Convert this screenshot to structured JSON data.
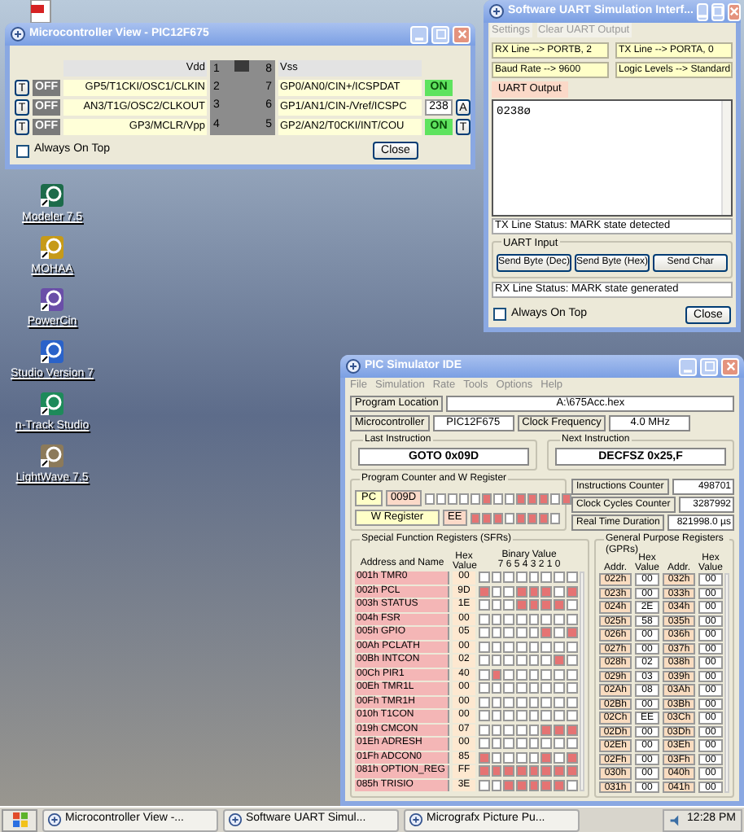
{
  "desktop_icons": [
    {
      "kind": "pdf"
    },
    {
      "kind": "app",
      "label": "Modeler 7.5"
    },
    {
      "kind": "app",
      "label": "MOHAA"
    },
    {
      "kind": "app",
      "label": "PowerCin"
    },
    {
      "kind": "app",
      "label": "Studio Version 7"
    },
    {
      "kind": "app",
      "label": "n-Track Studio"
    },
    {
      "kind": "app",
      "label": "LightWave 7.5"
    }
  ],
  "mcu_window": {
    "title": "Microcontroller View - PIC12F675",
    "pins": [
      {
        "kind": "power",
        "left": {
          "number": "1",
          "label": "Vdd"
        },
        "right": {
          "number": "8",
          "label": "Vss"
        }
      },
      {
        "kind": "io",
        "left": {
          "number": "2",
          "label": "GP5/T1CKI/OSC1/CLKIN",
          "button": "T",
          "state": {
            "text": "OFF",
            "on": false
          }
        },
        "right": {
          "number": "7",
          "label": "GP0/AN0/CIN+/ICSPDAT",
          "state": {
            "text": "ON",
            "on": true
          }
        }
      },
      {
        "kind": "io",
        "left": {
          "number": "3",
          "label": "AN3/T1G/OSC2/CLKOUT",
          "button": "T",
          "state": {
            "text": "OFF",
            "on": false
          }
        },
        "right": {
          "number": "6",
          "label": "GP1/AN1/CIN-/Vref/ICSPC",
          "analog": "238",
          "button": "A"
        }
      },
      {
        "kind": "io",
        "left": {
          "number": "4",
          "label": "GP3/MCLR/Vpp",
          "button": "T",
          "state": {
            "text": "OFF",
            "on": false
          }
        },
        "right": {
          "number": "5",
          "label": "GP2/AN2/T0CKI/INT/COU",
          "state": {
            "text": "ON",
            "on": true
          },
          "button": "T"
        }
      }
    ],
    "always_on_top": {
      "label": "Always On Top",
      "checked": false
    },
    "close": "Close"
  },
  "uart_window": {
    "title": "Software UART Simulation Interf...",
    "menu": [
      "Settings",
      "Clear UART Output"
    ],
    "info": [
      "RX Line --> PORTB, 2",
      "TX Line --> PORTA, 0",
      "Baud Rate --> 9600",
      "Logic Levels --> Standard"
    ],
    "output_label": "UART Output",
    "output": "0238ø",
    "tx_status": "TX Line Status: MARK state detected",
    "input_group": "UART Input",
    "buttons": [
      "Send Byte (Dec)",
      "Send Byte (Hex)",
      "Send Char"
    ],
    "rx_status": "RX Line Status: MARK state generated",
    "always_on_top": {
      "label": "Always On Top",
      "checked": false
    },
    "close": "Close"
  },
  "ide_window": {
    "title": "PIC Simulator IDE",
    "menu": [
      "File",
      "Simulation",
      "Rate",
      "Tools",
      "Options",
      "Help"
    ],
    "program_location": {
      "label": "Program Location",
      "value": "A:\\675Acc.hex"
    },
    "microcontroller": {
      "label": "Microcontroller",
      "value": "PIC12F675"
    },
    "clock_frequency": {
      "label": "Clock Frequency",
      "value": "4.0 MHz"
    },
    "last_instruction": {
      "label": "Last Instruction",
      "value": "GOTO 0x09D"
    },
    "next_instruction": {
      "label": "Next Instruction",
      "value": "DECFSZ 0x25,F"
    },
    "pc_group": "Program Counter and W Register",
    "pc": {
      "label": "PC",
      "value": "009D",
      "bits": [
        false,
        false,
        false,
        false,
        false,
        true,
        false,
        false,
        true,
        true,
        true,
        false,
        true
      ]
    },
    "w": {
      "label": "W Register",
      "value": "EE",
      "bits": [
        true,
        true,
        true,
        false,
        true,
        true,
        true,
        false
      ]
    },
    "counters": [
      {
        "label": "Instructions Counter",
        "value": "498701"
      },
      {
        "label": "Clock Cycles Counter",
        "value": "3287992"
      },
      {
        "label": "Real Time Duration",
        "value": "821998.0 µs"
      }
    ],
    "sfr": {
      "title": "Special Function Registers (SFRs)",
      "columns": [
        "Address and Name",
        "Hex Value",
        "Binary Value",
        "7 6 5 4 3 2 1 0"
      ],
      "rows": [
        {
          "name": "001h TMR0",
          "hex": "00",
          "bits": [
            false,
            false,
            false,
            false,
            false,
            false,
            false,
            false
          ]
        },
        {
          "name": "002h PCL",
          "hex": "9D",
          "bits": [
            true,
            false,
            false,
            true,
            true,
            true,
            false,
            true
          ]
        },
        {
          "name": "003h STATUS",
          "hex": "1E",
          "bits": [
            false,
            false,
            false,
            true,
            true,
            true,
            true,
            false
          ]
        },
        {
          "name": "004h FSR",
          "hex": "00",
          "bits": [
            false,
            false,
            false,
            false,
            false,
            false,
            false,
            false
          ]
        },
        {
          "name": "005h GPIO",
          "hex": "05",
          "bits": [
            false,
            false,
            false,
            false,
            false,
            true,
            false,
            true
          ]
        },
        {
          "name": "00Ah PCLATH",
          "hex": "00",
          "bits": [
            false,
            false,
            false,
            false,
            false,
            false,
            false,
            false
          ]
        },
        {
          "name": "00Bh INTCON",
          "hex": "02",
          "bits": [
            false,
            false,
            false,
            false,
            false,
            false,
            true,
            false
          ]
        },
        {
          "name": "00Ch PIR1",
          "hex": "40",
          "bits": [
            false,
            true,
            false,
            false,
            false,
            false,
            false,
            false
          ]
        },
        {
          "name": "00Eh TMR1L",
          "hex": "00",
          "bits": [
            false,
            false,
            false,
            false,
            false,
            false,
            false,
            false
          ]
        },
        {
          "name": "00Fh TMR1H",
          "hex": "00",
          "bits": [
            false,
            false,
            false,
            false,
            false,
            false,
            false,
            false
          ]
        },
        {
          "name": "010h T1CON",
          "hex": "00",
          "bits": [
            false,
            false,
            false,
            false,
            false,
            false,
            false,
            false
          ]
        },
        {
          "name": "019h CMCON",
          "hex": "07",
          "bits": [
            false,
            false,
            false,
            false,
            false,
            true,
            true,
            true
          ]
        },
        {
          "name": "01Eh ADRESH",
          "hex": "00",
          "bits": [
            false,
            false,
            false,
            false,
            false,
            false,
            false,
            false
          ]
        },
        {
          "name": "01Fh ADCON0",
          "hex": "85",
          "bits": [
            true,
            false,
            false,
            false,
            false,
            true,
            false,
            true
          ]
        },
        {
          "name": "081h OPTION_REG",
          "hex": "FF",
          "bits": [
            true,
            true,
            true,
            true,
            true,
            true,
            true,
            true
          ]
        },
        {
          "name": "085h TRISIO",
          "hex": "3E",
          "bits": [
            false,
            false,
            true,
            true,
            true,
            true,
            true,
            false
          ]
        }
      ]
    },
    "gpr": {
      "title": "General Purpose Registers (GPRs)",
      "columns": [
        "Addr.",
        "Hex Value",
        "Addr.",
        "Hex Value"
      ],
      "rows": [
        [
          "022h",
          "00",
          "032h",
          "00"
        ],
        [
          "023h",
          "00",
          "033h",
          "00"
        ],
        [
          "024h",
          "2E",
          "034h",
          "00"
        ],
        [
          "025h",
          "58",
          "035h",
          "00"
        ],
        [
          "026h",
          "00",
          "036h",
          "00"
        ],
        [
          "027h",
          "00",
          "037h",
          "00"
        ],
        [
          "028h",
          "02",
          "038h",
          "00"
        ],
        [
          "029h",
          "03",
          "039h",
          "00"
        ],
        [
          "02Ah",
          "08",
          "03Ah",
          "00"
        ],
        [
          "02Bh",
          "00",
          "03Bh",
          "00"
        ],
        [
          "02Ch",
          "EE",
          "03Ch",
          "00"
        ],
        [
          "02Dh",
          "00",
          "03Dh",
          "00"
        ],
        [
          "02Eh",
          "00",
          "03Eh",
          "00"
        ],
        [
          "02Fh",
          "00",
          "03Fh",
          "00"
        ],
        [
          "030h",
          "00",
          "040h",
          "00"
        ],
        [
          "031h",
          "00",
          "041h",
          "00"
        ]
      ]
    }
  },
  "taskbar": {
    "tasks": [
      {
        "label": "Microcontroller View -...",
        "selected": false
      },
      {
        "label": "Software UART Simul...",
        "selected": false
      },
      {
        "label": "Micrografx Picture Pu...",
        "selected": false
      }
    ],
    "clock": "12:28 PM"
  }
}
